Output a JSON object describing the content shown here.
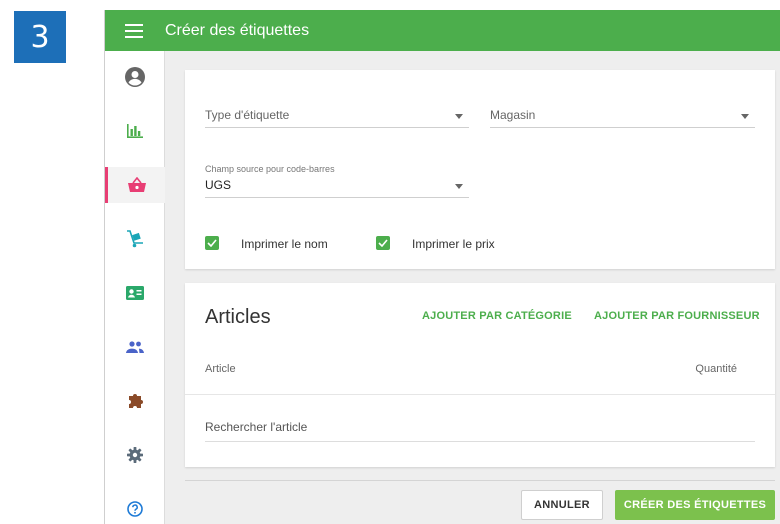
{
  "step_badge": "3",
  "header": {
    "title": "Créer des étiquettes"
  },
  "colors": {
    "topbar": "#4cae4c",
    "accent_green": "#4cae4c",
    "active_pink": "#e83e74",
    "step_blue": "#1d6fb8"
  },
  "sidebar": {
    "items": [
      {
        "icon": "account-icon",
        "active": false
      },
      {
        "icon": "bar-chart-icon",
        "active": false
      },
      {
        "icon": "basket-icon",
        "active": true
      },
      {
        "icon": "hand-truck-icon",
        "active": false
      },
      {
        "icon": "id-card-icon",
        "active": false
      },
      {
        "icon": "people-icon",
        "active": false
      },
      {
        "icon": "puzzle-icon",
        "active": false
      },
      {
        "icon": "gear-icon",
        "active": false
      },
      {
        "icon": "help-icon",
        "active": false
      }
    ]
  },
  "form": {
    "label_type_placeholder": "Type d'étiquette",
    "store_placeholder": "Magasin",
    "barcode_source_label": "Champ source pour code-barres",
    "barcode_source_value": "UGS",
    "print_name_label": "Imprimer le nom",
    "print_name_checked": true,
    "print_price_label": "Imprimer le prix",
    "print_price_checked": true
  },
  "articles": {
    "title": "Articles",
    "add_by_category": "AJOUTER PAR CATÉGORIE",
    "add_by_supplier": "AJOUTER PAR FOURNISSEUR",
    "col_article": "Article",
    "col_quantity": "Quantité",
    "search_placeholder": "Rechercher l'article"
  },
  "footer": {
    "cancel_label": "ANNULER",
    "create_label": "CRÉER DES ÉTIQUETTES"
  }
}
